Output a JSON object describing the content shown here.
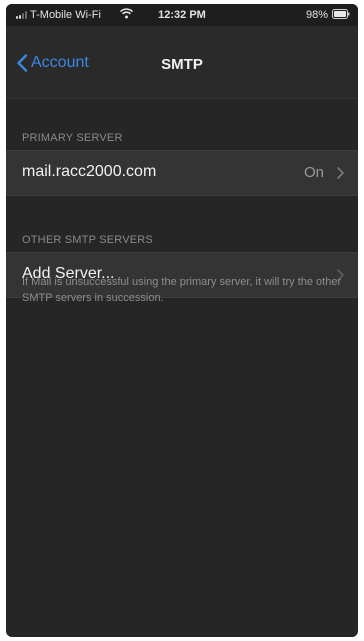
{
  "status_bar": {
    "carrier": "T-Mobile Wi-Fi",
    "time": "12:32 PM",
    "battery": "98%"
  },
  "nav": {
    "back_label": "Account",
    "title": "SMTP"
  },
  "primary_server": {
    "header": "PRIMARY SERVER",
    "host": "mail.racc2000.com",
    "status": "On"
  },
  "other_servers": {
    "header": "OTHER SMTP SERVERS",
    "add_label": "Add Server...",
    "footer": "If Mail is unsuccessful using the primary server, it will try the other SMTP servers in succession."
  },
  "colors": {
    "accent": "#3d87e3",
    "background": "#262626",
    "cell": "#343434"
  }
}
